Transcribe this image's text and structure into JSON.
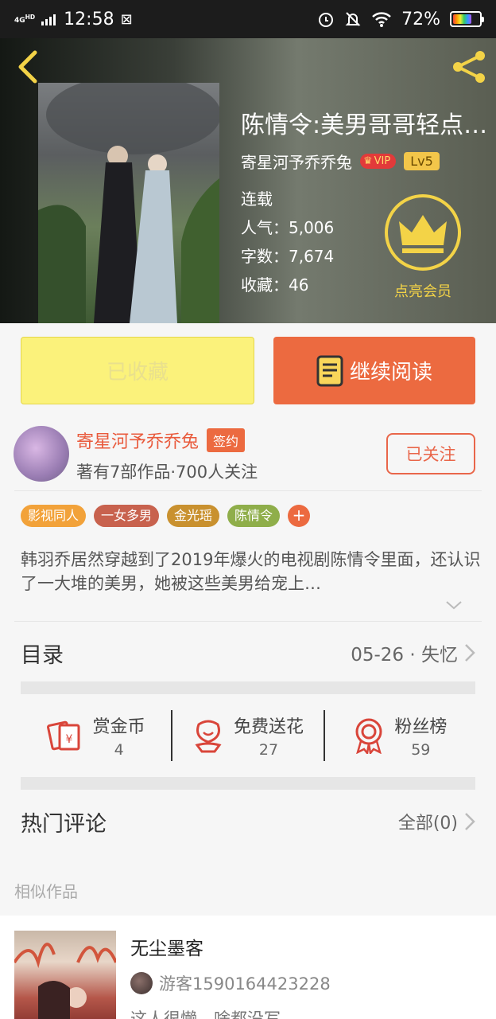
{
  "status_bar": {
    "time": "12:58",
    "network": "4G HD",
    "battery": "72%"
  },
  "book": {
    "title": "陈情令:美男哥哥轻点…",
    "author": "寄星河予乔乔兔",
    "vip_label": "VIP",
    "level": "Lv5",
    "status": "连载",
    "popularity": "人气：5,006",
    "word_count": "字数：7,674",
    "favorites": "收藏：46",
    "member_label": "点亮会员"
  },
  "actions": {
    "favorited_label": "已收藏",
    "continue_label": "继续阅读"
  },
  "author_info": {
    "name": "寄星河予乔乔兔",
    "signed_badge": "签约",
    "stats": "著有7部作品·700人关注",
    "follow_label": "已关注"
  },
  "tags": [
    {
      "label": "影视同人",
      "color": "#f2a23a"
    },
    {
      "label": "一女多男",
      "color": "#c8624e"
    },
    {
      "label": "金光瑶",
      "color": "#c9912f"
    },
    {
      "label": "陈情令",
      "color": "#8fae4a"
    }
  ],
  "tag_more": "+",
  "description": "韩羽乔居然穿越到了2019年爆火的电视剧陈情令里面，还认识了一大堆的美男，她被这些美男给宠上…",
  "catalog": {
    "label": "目录",
    "latest": "05-26 · 失忆"
  },
  "stats": {
    "reward_label": "赏金币",
    "reward_value": "4",
    "flower_label": "免费送花",
    "flower_value": "27",
    "fans_label": "粉丝榜",
    "fans_value": "59"
  },
  "comments": {
    "label": "热门评论",
    "all_label": "全部(0)"
  },
  "similar": {
    "heading": "相似作品",
    "items": [
      {
        "title": "无尘墨客",
        "author": "游客1590164423228",
        "intro": "这人很懒，啥都没写"
      }
    ]
  },
  "colors": {
    "accent": "#ec6a40",
    "favorite_button": "#fbf27b",
    "member_gold": "#f3d347"
  }
}
